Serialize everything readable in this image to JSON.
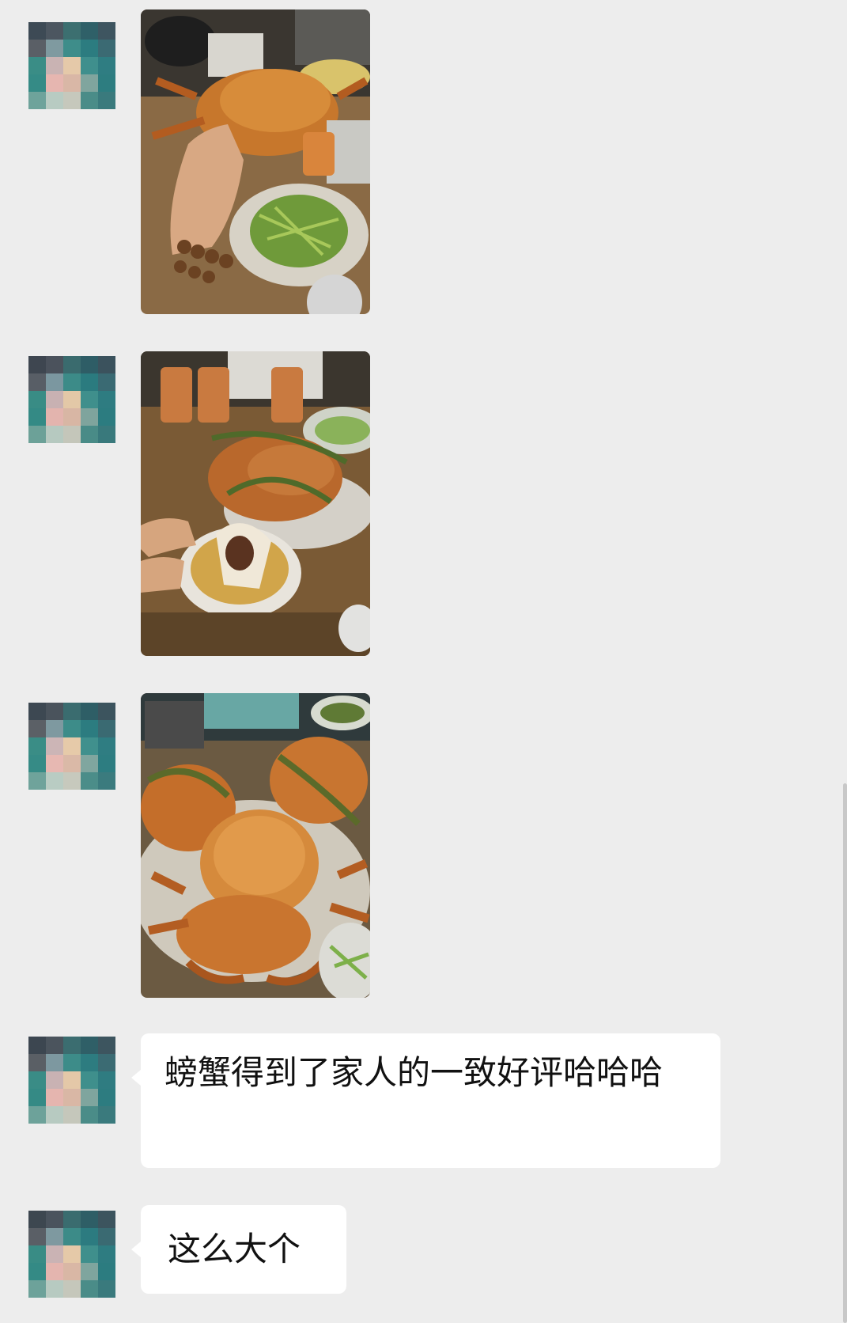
{
  "chat": {
    "messages": [
      {
        "type": "image",
        "description_icon": "crab-photo-icon"
      },
      {
        "type": "image",
        "description_icon": "crab-rice-photo-icon"
      },
      {
        "type": "image",
        "description_icon": "crab-platter-photo-icon"
      },
      {
        "type": "text",
        "text": "螃蟹得到了家人的一致好评哈哈哈"
      },
      {
        "type": "text",
        "text": "这么大个"
      }
    ]
  },
  "colors": {
    "background": "#ededed",
    "bubble": "#ffffff",
    "text": "#111111"
  }
}
